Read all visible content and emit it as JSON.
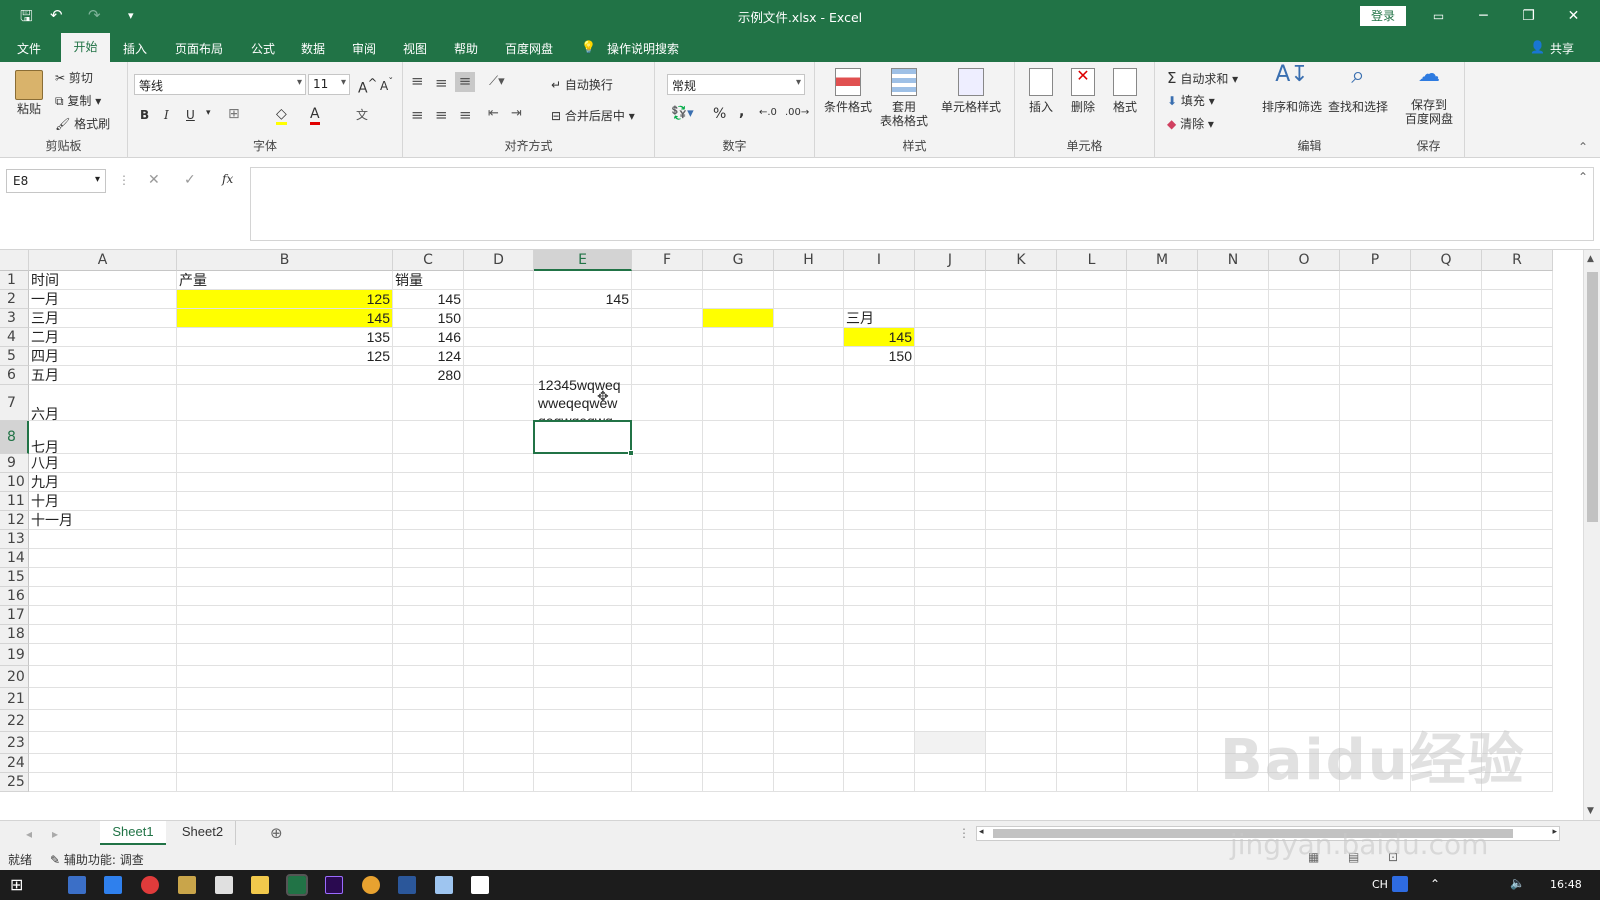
{
  "window": {
    "title": "示例文件.xlsx  -  Excel",
    "login": "登录",
    "minimize": "─",
    "restore": "❐",
    "close": "✕"
  },
  "tabs": [
    "文件",
    "开始",
    "插入",
    "页面布局",
    "公式",
    "数据",
    "审阅",
    "视图",
    "帮助",
    "百度网盘",
    "操作说明搜索"
  ],
  "share": "共享",
  "ribbon": {
    "clipboard": {
      "paste": "粘贴",
      "cut": "剪切",
      "copy": "复制",
      "format_painter": "格式刷",
      "label": "剪贴板"
    },
    "font": {
      "name": "等线",
      "size": "11",
      "label": "字体",
      "bold": "B",
      "italic": "I",
      "underline": "U",
      "grow": "A",
      "shrink": "A"
    },
    "alignment": {
      "wrap": "自动换行",
      "merge": "合并后居中",
      "label": "对齐方式"
    },
    "number": {
      "format": "常规",
      "percent": "%",
      "comma": ",",
      "label": "数字"
    },
    "styles": {
      "conditional": "条件格式",
      "table_1": "套用",
      "table_2": "表格格式",
      "cell_styles": "单元格样式",
      "label": "样式"
    },
    "cells": {
      "insert": "插入",
      "delete": "删除",
      "format": "格式",
      "label": "单元格"
    },
    "editing": {
      "autosum": "自动求和",
      "fill": "填充",
      "clear": "清除",
      "sort": "排序和筛选",
      "find": "查找和选择",
      "label": "编辑"
    },
    "save": {
      "line1": "保存到",
      "line2": "百度网盘",
      "label": "保存"
    }
  },
  "formula_bar": {
    "name_box": "E8",
    "formula": "",
    "fx": "fx",
    "cancel": "✕",
    "confirm": "✓"
  },
  "columns": [
    "A",
    "B",
    "C",
    "D",
    "E",
    "F",
    "G",
    "H",
    "I",
    "J",
    "K",
    "L",
    "M",
    "N",
    "O",
    "P",
    "Q",
    "R"
  ],
  "rows": [
    "1",
    "2",
    "3",
    "4",
    "5",
    "6",
    "7",
    "8",
    "9",
    "10",
    "11",
    "12",
    "13",
    "14",
    "15",
    "16",
    "17",
    "18",
    "19",
    "20",
    "21",
    "22",
    "23",
    "24",
    "25"
  ],
  "cells": {
    "A1": "时间",
    "B1": "产量",
    "C1": "销量",
    "A2": "一月",
    "B2": "125",
    "C2": "145",
    "E2": "145",
    "A3": "三月",
    "B3": "145",
    "C3": "150",
    "I3": "三月",
    "A4": "二月",
    "B4": "135",
    "C4": "146",
    "I4": "145",
    "A5": "四月",
    "B5": "125",
    "C5": "124",
    "I5": "150",
    "A6": "五月",
    "C6": "280",
    "A7": "六月",
    "E7a": "12345wqweq",
    "E7b": "wweqeqwew",
    "E7c": "qeqwqeqwq",
    "A8": "七月",
    "A9": "八月",
    "A10": "九月",
    "A11": "十月",
    "A12": "十一月"
  },
  "highlight_color": "#ffff00",
  "sheets": [
    "Sheet1",
    "Sheet2"
  ],
  "status": {
    "ready": "就绪",
    "accessibility": "辅助功能: 调查"
  },
  "taskbar": {
    "lang": "CH",
    "time": "16:48"
  },
  "watermark": {
    "brand": "Baidu经验",
    "url": "jingyan.baidu.com"
  }
}
